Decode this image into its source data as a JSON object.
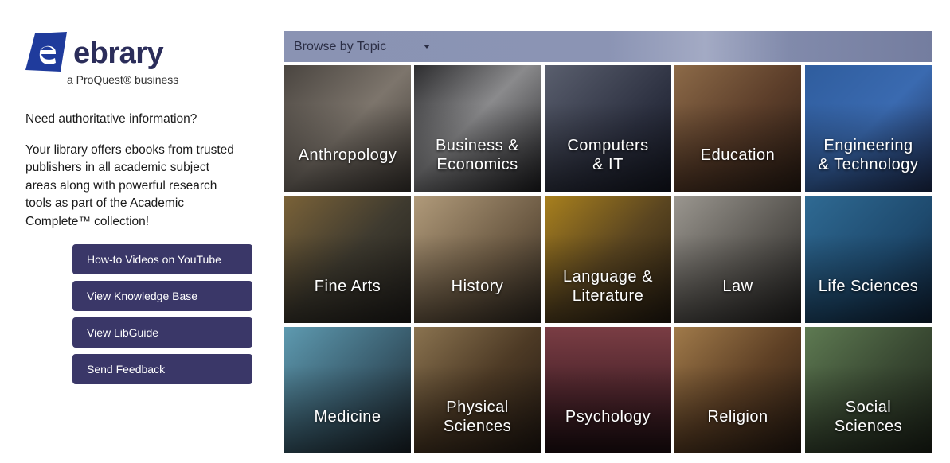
{
  "logo": {
    "wordmark": "ebrary",
    "tagline": "a ProQuest® business",
    "brand_color": "#2b2d5a",
    "accent_color": "#1f3b9c"
  },
  "intro": {
    "question": "Need authoritative information?",
    "body": "Your library offers ebooks from trusted publishers in all academic subject areas along with powerful research tools as part of the Academic Complete™ collection!"
  },
  "buttons": [
    {
      "label": "How-to Videos on YouTube"
    },
    {
      "label": "View Knowledge Base"
    },
    {
      "label": "View LibGuide"
    },
    {
      "label": "Send Feedback"
    }
  ],
  "browse": {
    "label": "Browse by Topic",
    "icon": "caret-down-icon"
  },
  "topics": [
    {
      "line1": "Anthropology",
      "line2": "",
      "bg": "linear-gradient(135deg,#4a4540,#7d756c 50%,#3b3631)"
    },
    {
      "line1": "Business &",
      "line2": "Economics",
      "bg": "linear-gradient(135deg,#2d2d2f,#8a8a8c 45%,#1f1f22)"
    },
    {
      "line1": "Computers",
      "line2": "& IT",
      "bg": "linear-gradient(135deg,#5a5f6e,#2c3040 60%,#141722)"
    },
    {
      "line1": "Education",
      "line2": "",
      "bg": "linear-gradient(135deg,#8c6a48,#5c3e2a 50%,#2a1c14)"
    },
    {
      "line1": "Engineering",
      "line2": "& Technology",
      "bg": "linear-gradient(135deg,#2f5d9e,#3a6ab0 50%,#1d2d52)"
    },
    {
      "line1": "Fine Arts",
      "line2": "",
      "bg": "linear-gradient(135deg,#7a6238,#3e3a2f 50%,#1f1d1a)"
    },
    {
      "line1": "History",
      "line2": "",
      "bg": "linear-gradient(135deg,#b09a7a,#6e5c45 55%,#2f2820)"
    },
    {
      "line1": "Language &",
      "line2": "Literature",
      "bg": "linear-gradient(135deg,#a8801e,#5a4520 50%,#231a10)"
    },
    {
      "line1": "Law",
      "line2": "",
      "bg": "linear-gradient(135deg,#9a968f,#5d5a55 50%,#222120)"
    },
    {
      "line1": "Life Sciences",
      "line2": "",
      "bg": "linear-gradient(135deg,#2f6a93,#1e4a6e 55%,#0f2238)"
    },
    {
      "line1": "Medicine",
      "line2": "",
      "bg": "linear-gradient(135deg,#5e9ab0,#3b5f70 50%,#1a2228)"
    },
    {
      "line1": "Physical",
      "line2": "Sciences",
      "bg": "linear-gradient(135deg,#8a7350,#4d3a25 50%,#201711)"
    },
    {
      "line1": "Psychology",
      "line2": "",
      "bg": "linear-gradient(180deg,#7a3d44,#4a232a 55%,#1e0e12)"
    },
    {
      "line1": "Religion",
      "line2": "",
      "bg": "linear-gradient(135deg,#a07a4a,#5e4025 50%,#241810)"
    },
    {
      "line1": "Social",
      "line2": "Sciences",
      "bg": "linear-gradient(135deg,#5e7a52,#3a4a33 50%,#1c2218)"
    }
  ]
}
